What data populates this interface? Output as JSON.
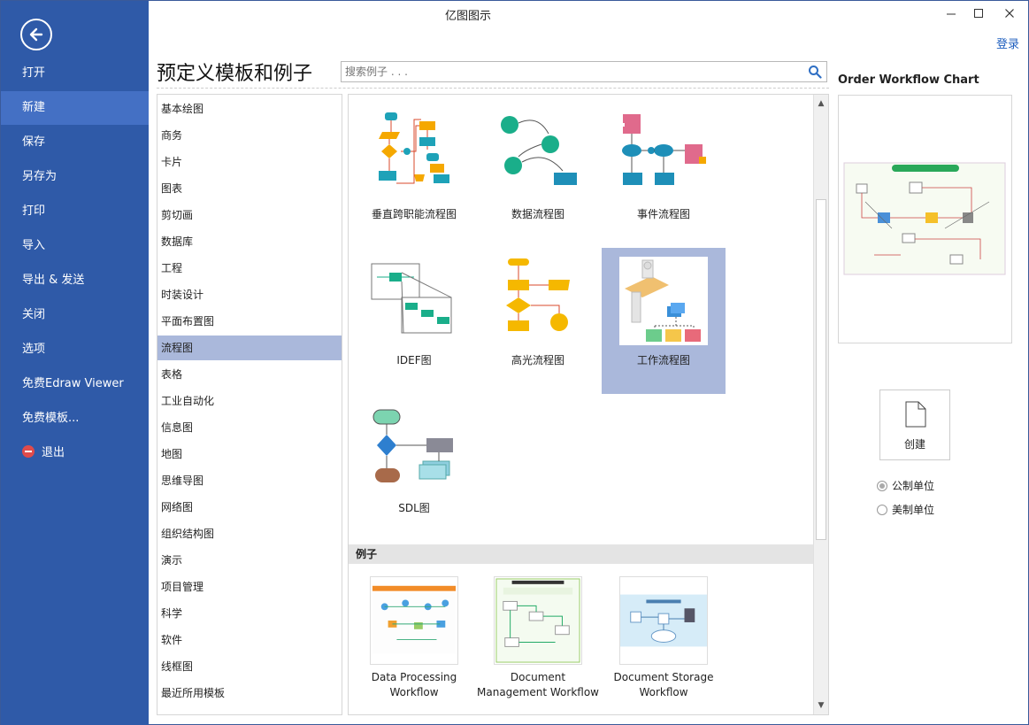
{
  "window": {
    "title": "亿图图示",
    "login": "登录"
  },
  "sidebar": {
    "items": [
      {
        "label": "打开"
      },
      {
        "label": "新建"
      },
      {
        "label": "保存"
      },
      {
        "label": "另存为"
      },
      {
        "label": "打印"
      },
      {
        "label": "导入"
      },
      {
        "label": "导出 & 发送"
      },
      {
        "label": "关闭"
      },
      {
        "label": "选项"
      },
      {
        "label": "免费Edraw Viewer"
      },
      {
        "label": "免费模板..."
      },
      {
        "label": "退出"
      }
    ]
  },
  "main": {
    "heading": "预定义模板和例子",
    "search_placeholder": "搜索例子 . . .",
    "categories": [
      "基本绘图",
      "商务",
      "卡片",
      "图表",
      "剪切画",
      "数据库",
      "工程",
      "时装设计",
      "平面布置图",
      "流程图",
      "表格",
      "工业自动化",
      "信息图",
      "地图",
      "思维导图",
      "网络图",
      "组织结构图",
      "演示",
      "项目管理",
      "科学",
      "软件",
      "线框图",
      "最近所用模板"
    ],
    "selected_category": "流程图",
    "templates": [
      {
        "label": "垂直跨职能流程图"
      },
      {
        "label": "数据流程图"
      },
      {
        "label": "事件流程图"
      },
      {
        "label": "IDEF图"
      },
      {
        "label": "高光流程图"
      },
      {
        "label": "工作流程图"
      },
      {
        "label": "SDL图"
      }
    ],
    "examples_header": "例子",
    "examples": [
      {
        "label": "Data Processing Workflow"
      },
      {
        "label": "Document Management Workflow"
      },
      {
        "label": "Document Storage Workflow"
      }
    ]
  },
  "preview": {
    "title": "Order Workflow Chart",
    "create_label": "创建",
    "units": [
      {
        "label": "公制单位",
        "selected": true
      },
      {
        "label": "美制单位",
        "selected": false
      }
    ]
  },
  "colors": {
    "sidebar": "#2f5aa8",
    "sidebar_active": "#4470c4",
    "selection": "#aab8db"
  }
}
